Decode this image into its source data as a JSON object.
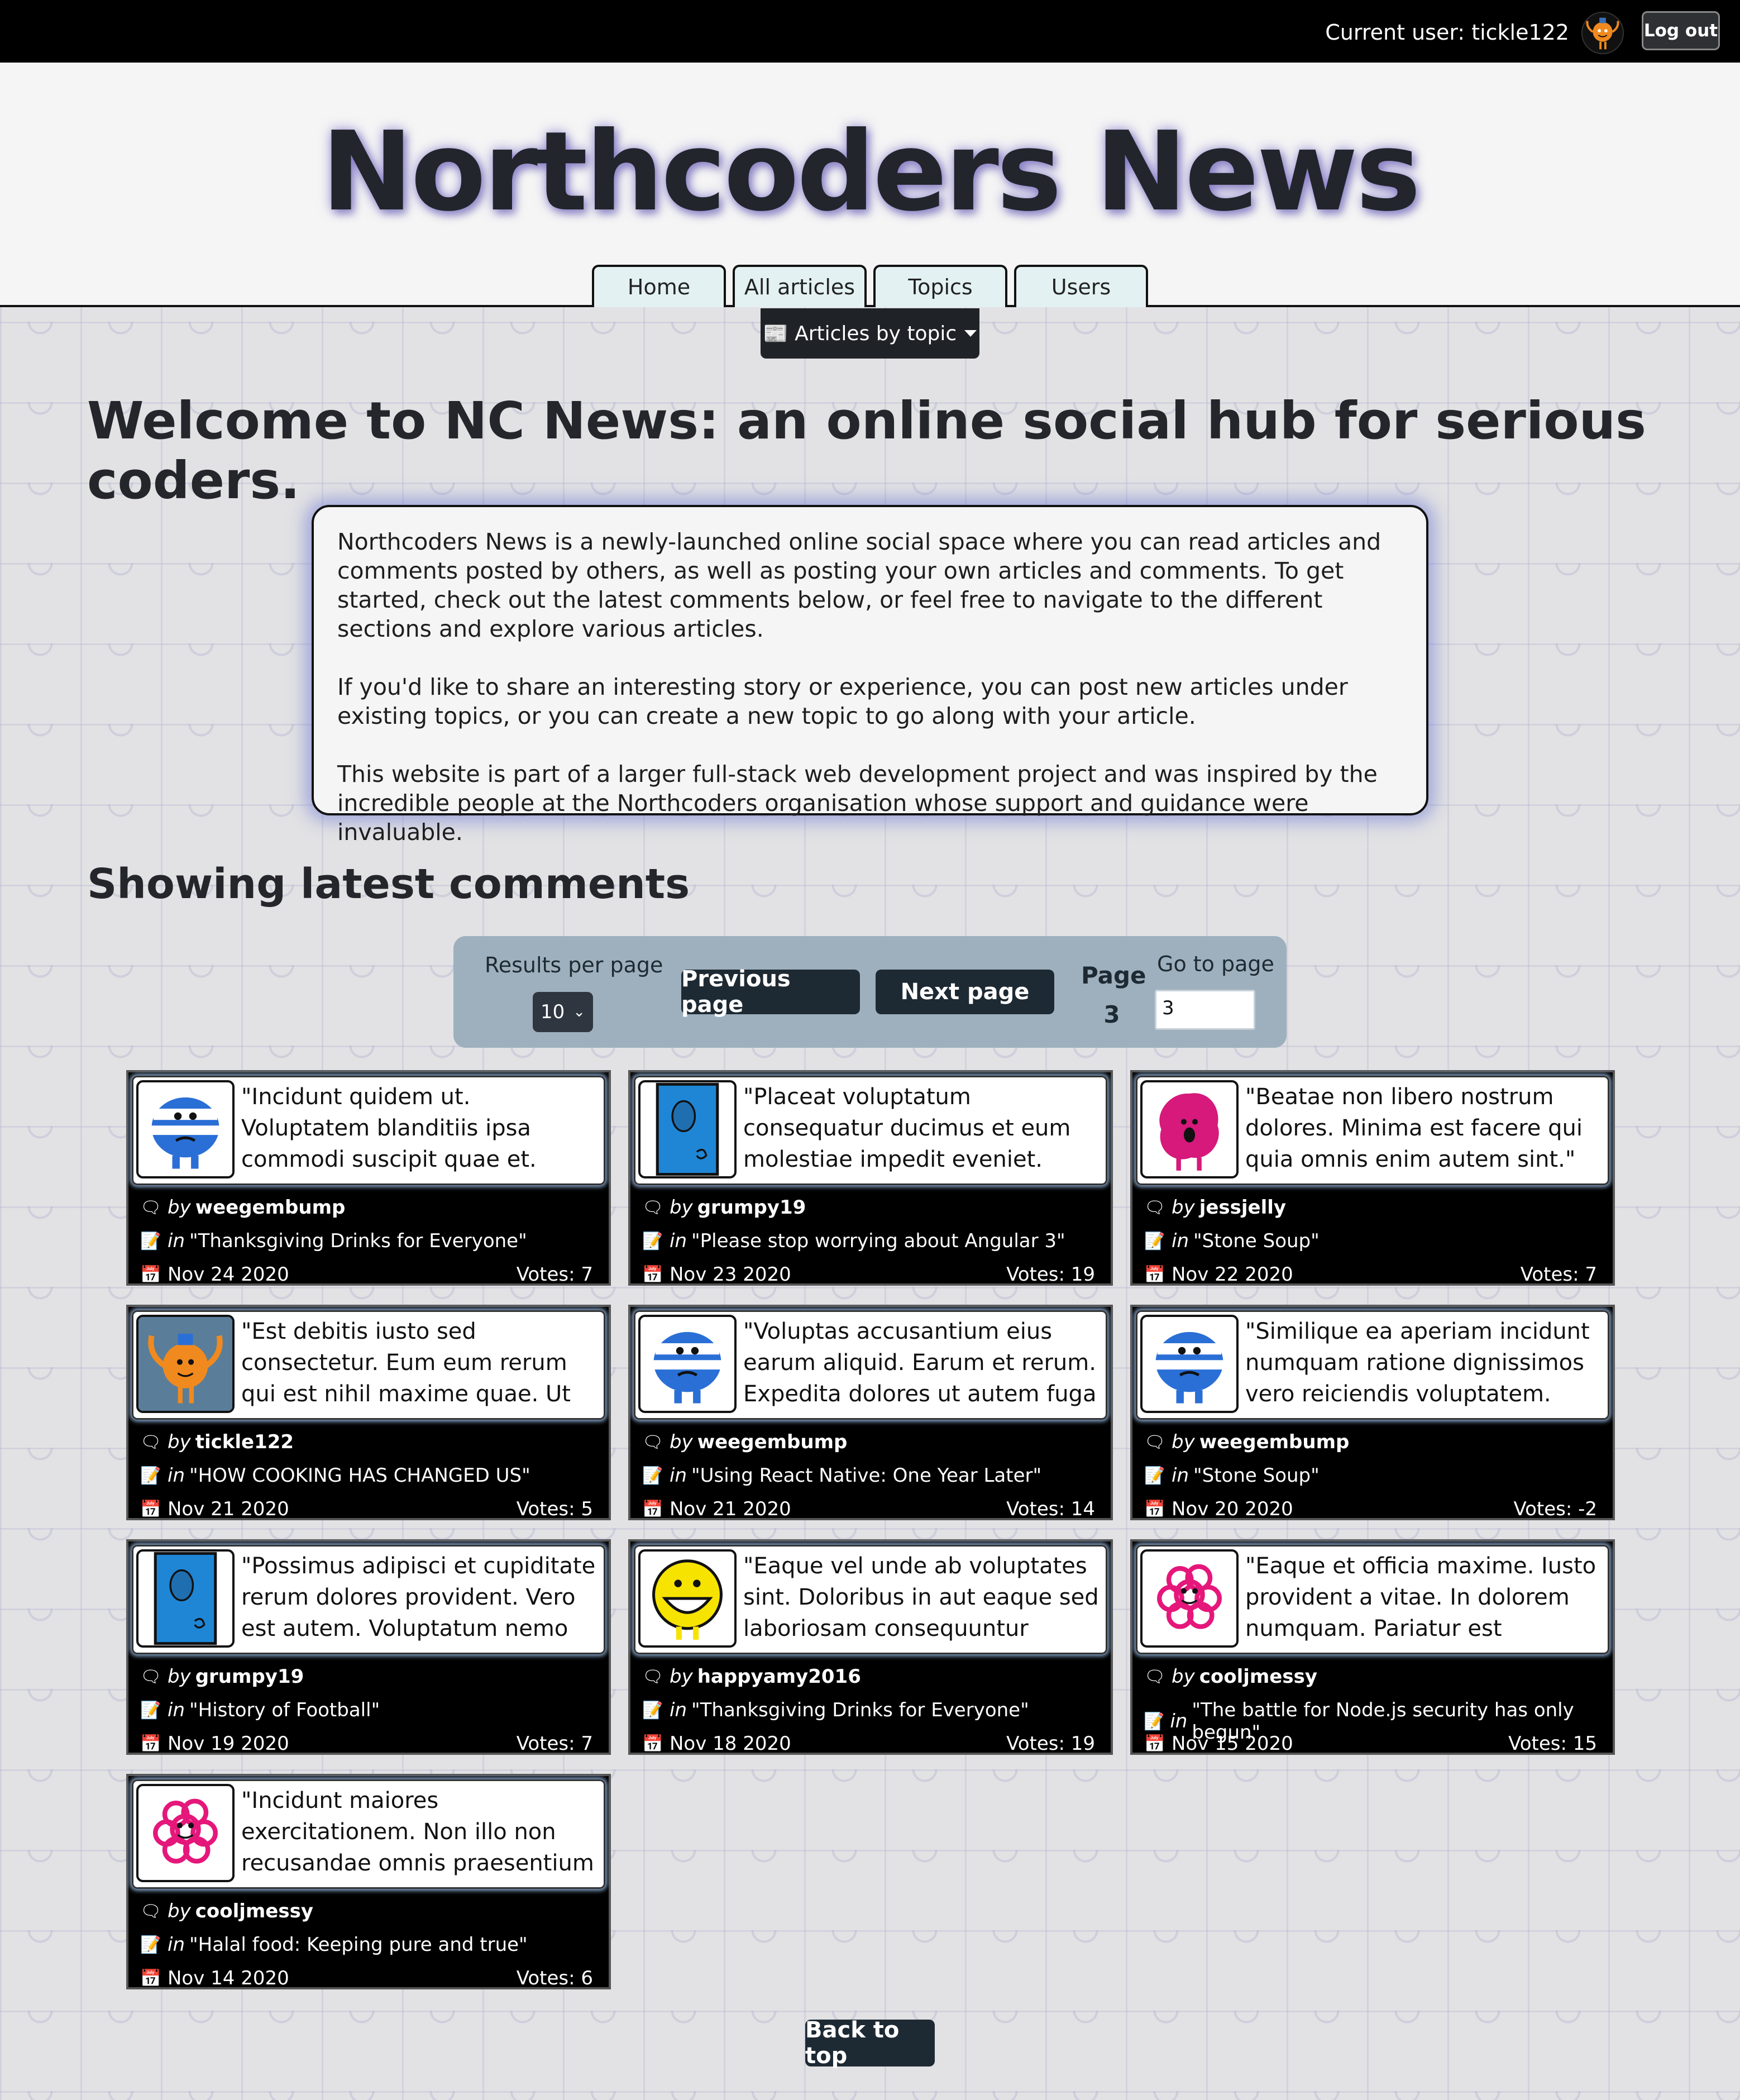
{
  "topbar": {
    "current_user": "Current user: tickle122",
    "logout": "Log out"
  },
  "header": {
    "title": "Northcoders News",
    "nav": [
      "Home",
      "All articles",
      "Topics",
      "Users"
    ],
    "topic_dropdown": "📰 Articles by topic"
  },
  "main": {
    "heading": "Welcome to NC News: an online social hub for serious coders.",
    "intro": [
      "Northcoders News is a newly-launched online social space where you can read articles and comments posted by others, as well as posting your own articles and comments. To get started, check out the latest comments below, or feel free to navigate to the different sections and explore various articles.",
      "If you'd like to share an interesting story or experience, you can post new articles under existing topics, or you can create a new topic to go along with your article.",
      "This website is part of a larger full-stack web development project and was inspired by the incredible people at the Northcoders organisation whose support and guidance were invaluable."
    ],
    "section_heading": "Showing latest comments"
  },
  "pagination": {
    "results_label": "Results per page",
    "results_value": "10",
    "prev": "Previous page",
    "next": "Next page",
    "page_label": "Page",
    "page_number": "3",
    "goto_label": "Go to page",
    "goto_value": "3"
  },
  "icons": {
    "author": "speech-bubble-icon",
    "article": "memo-icon",
    "date": "calendar-icon"
  },
  "comments": [
    {
      "snippet": "\"Incidunt quidem ut. Voluptatem blanditiis ipsa commodi suscipit quae et. Magni assumenda veritatis...",
      "author": "weegembump",
      "article": "\"Thanksgiving Drinks for Everyone\"",
      "date": "Nov 24 2020",
      "votes": "Votes: 7",
      "avatar": "mr-bump"
    },
    {
      "snippet": "\"Placeat voluptatum consequatur ducimus et eum molestiae impedit eveniet. Recusandae rerum voluptas...",
      "author": "grumpy19",
      "article": "\"Please stop worrying about Angular 3\"",
      "date": "Nov 23 2020",
      "votes": "Votes: 19",
      "avatar": "mr-grumpy"
    },
    {
      "snippet": "\"Beatae non libero nostrum dolores. Minima est facere qui quia omnis enim autem sint.\"",
      "author": "jessjelly",
      "article": "\"Stone Soup\"",
      "date": "Nov 22 2020",
      "votes": "Votes: 7",
      "avatar": "mr-jelly"
    },
    {
      "snippet": "\"Est debitis iusto sed consectetur. Eum eum rerum qui est nihil maxime quae. Ut autem velit sint iste...",
      "author": "tickle122",
      "article": "\"HOW COOKING HAS CHANGED US\"",
      "date": "Nov 21 2020",
      "votes": "Votes: 5",
      "avatar": "mr-tickle"
    },
    {
      "snippet": "\"Voluptas accusantium eius earum aliquid. Earum et rerum. Expedita dolores ut autem fuga id accusamus...",
      "author": "weegembump",
      "article": "\"Using React Native: One Year Later\"",
      "date": "Nov 21 2020",
      "votes": "Votes: 14",
      "avatar": "mr-bump"
    },
    {
      "snippet": "\"Similique ea aperiam incidunt numquam ratione dignissimos vero reiciendis voluptatem. Saepe quas...",
      "author": "weegembump",
      "article": "\"Stone Soup\"",
      "date": "Nov 20 2020",
      "votes": "Votes: -2",
      "avatar": "mr-bump"
    },
    {
      "snippet": "\"Possimus adipisci et cupiditate rerum dolores provident. Vero est autem. Voluptatum nemo officia...",
      "author": "grumpy19",
      "article": "\"History of Football\"",
      "date": "Nov 19 2020",
      "votes": "Votes: 7",
      "avatar": "mr-grumpy"
    },
    {
      "snippet": "\"Eaque vel unde ab voluptates sint. Doloribus in aut eaque sed laboriosam consequuntur voluptatem molestiae...",
      "author": "happyamy2016",
      "article": "\"Thanksgiving Drinks for Everyone\"",
      "date": "Nov 18 2020",
      "votes": "Votes: 19",
      "avatar": "mr-happy"
    },
    {
      "snippet": "\"Eaque et officia maxime. Iusto provident a vitae. In dolorem numquam. Pariatur est laudantium...",
      "author": "cooljmessy",
      "article": "\"The battle for Node.js security has only begun\"",
      "date": "Nov 15 2020",
      "votes": "Votes: 15",
      "avatar": "mr-messy"
    },
    {
      "snippet": "\"Incidunt maiores exercitationem. Non illo non recusandae omnis praesentium architecto. Molestiae...",
      "author": "cooljmessy",
      "article": "\"Halal food: Keeping pure and true\"",
      "date": "Nov 14 2020",
      "votes": "Votes: 6",
      "avatar": "mr-messy"
    }
  ],
  "labels": {
    "by": "by",
    "in": "in"
  },
  "footer": {
    "back_to_top": "Back to top"
  }
}
